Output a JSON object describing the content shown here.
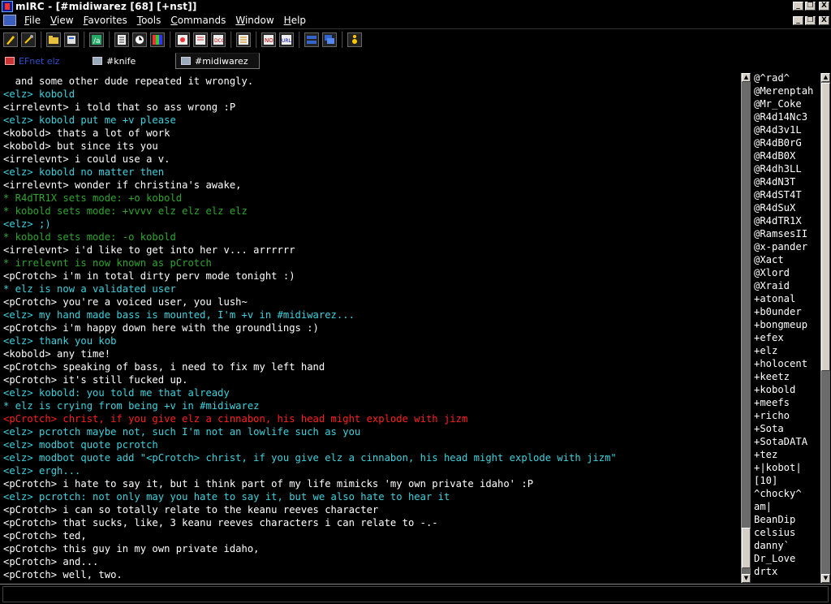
{
  "window": {
    "title": "mIRC - [#midiwarez [68] [+nst]]",
    "buttons": {
      "minimize": "_",
      "restore": "❐",
      "close": "X"
    }
  },
  "menu": [
    "File",
    "View",
    "Favorites",
    "Tools",
    "Commands",
    "Window",
    "Help"
  ],
  "toolbar": {
    "icons": [
      "connect-icon",
      "options-icon",
      "channels-folder-icon",
      "address-book-icon",
      "scripts-editor-icon",
      "dcc-send-icon",
      "timer-icon",
      "colors-icon",
      "dcc-chat-icon",
      "fonts-icon",
      "dcc-icon",
      "log-icon",
      "notify-icon",
      "url-icon",
      "tile-icon",
      "cascade-icon",
      "help-icon"
    ]
  },
  "tabs": [
    {
      "label": "EFnet elz",
      "kind": "status"
    },
    {
      "label": "#knife",
      "kind": "normal"
    },
    {
      "label": "#midiwarez",
      "kind": "active"
    }
  ],
  "colors": {
    "normal": "#ffffff",
    "self": "#3fd1dc",
    "event": "#2fa52f",
    "highlight": "#ff1f1f"
  },
  "chat": [
    {
      "t": "  and some other dude repeated it wrongly.",
      "c": "white"
    },
    {
      "t": "<elz> kobold",
      "c": "cyan"
    },
    {
      "t": "<irrelevnt> i told that so ass wrong :P",
      "c": "white"
    },
    {
      "t": "<elz> kobold put me +v please",
      "c": "cyan"
    },
    {
      "t": "<kobold> thats a lot of work",
      "c": "white"
    },
    {
      "t": "<kobold> but since its you",
      "c": "white"
    },
    {
      "t": "<irrelevnt> i could use a v.",
      "c": "white"
    },
    {
      "t": "<elz> kobold no matter then",
      "c": "cyan"
    },
    {
      "t": "<irrelevnt> wonder if christina's awake,",
      "c": "white"
    },
    {
      "t": "* R4dTR1X sets mode: +o kobold",
      "c": "green"
    },
    {
      "t": "* kobold sets mode: +vvvv elz elz elz elz",
      "c": "green"
    },
    {
      "t": "<elz> ;)",
      "c": "cyan"
    },
    {
      "t": "* kobold sets mode: -o kobold",
      "c": "green"
    },
    {
      "t": "<irrelevnt> i'd like to get into her v... arrrrrr",
      "c": "white"
    },
    {
      "t": "* irrelevnt is now known as pCrotch",
      "c": "green"
    },
    {
      "t": "<pCrotch> i'm in total dirty perv mode tonight :)",
      "c": "white"
    },
    {
      "t": "* elz is now a validated user",
      "c": "cyan"
    },
    {
      "t": "<pCrotch> you're a voiced user, you lush~",
      "c": "white"
    },
    {
      "t": "<elz> my hand made bass is mounted, I'm +v in #midiwarez...",
      "c": "cyan"
    },
    {
      "t": "<pCrotch> i'm happy down here with the groundlings :)",
      "c": "white"
    },
    {
      "t": "<elz> thank you kob",
      "c": "cyan"
    },
    {
      "t": "<kobold> any time!",
      "c": "white"
    },
    {
      "t": "<pCrotch> speaking of bass, i need to fix my left hand",
      "c": "white"
    },
    {
      "t": "<pCrotch> it's still fucked up.",
      "c": "white"
    },
    {
      "t": "<elz> kobold: you told me that already",
      "c": "cyan"
    },
    {
      "t": "* elz is crying from being +v in #midiwarez",
      "c": "cyan"
    },
    {
      "t": "<pCrotch> christ, if you give elz a cinnabon, his head might explode with jizm",
      "c": "red"
    },
    {
      "t": "<elz> pcrotch maybe not, such I'm not an lowlife such as you",
      "c": "cyan"
    },
    {
      "t": "<elz> modbot quote pcrotch",
      "c": "cyan"
    },
    {
      "t": "<elz> modbot quote add \"<pCrotch> christ, if you give elz a cinnabon, his head might explode with jizm\"",
      "c": "cyan"
    },
    {
      "t": "<elz> ergh...",
      "c": "cyan"
    },
    {
      "t": "<pCrotch> i hate to say it, but i think part of my life mimicks 'my own private idaho' :P",
      "c": "white"
    },
    {
      "t": "<elz> pcrotch: not only may you hate to say it, but we also hate to hear it",
      "c": "cyan"
    },
    {
      "t": "<pCrotch> i can so totally relate to the keanu reeves character",
      "c": "white"
    },
    {
      "t": "<pCrotch> that sucks, like, 3 keanu reeves characters i can relate to -.-",
      "c": "white"
    },
    {
      "t": "<pCrotch> ted,",
      "c": "white"
    },
    {
      "t": "<pCrotch> this guy in my own private idaho,",
      "c": "white"
    },
    {
      "t": "<pCrotch> and...",
      "c": "white"
    },
    {
      "t": "<pCrotch> well, two.",
      "c": "white"
    }
  ],
  "nicks": [
    "@^rad^",
    "@Merenptah",
    "@Mr_Coke",
    "@R4d14Nc3",
    "@R4d3v1L",
    "@R4dB0rG",
    "@R4dB0X",
    "@R4dh3LL",
    "@R4dN3T",
    "@R4dST4T",
    "@R4dSuX",
    "@R4dTR1X",
    "@RamsesII",
    "@x-pander",
    "@Xact",
    "@Xlord",
    "@Xraid",
    "+atonal",
    "+b0under",
    "+bongmeup",
    "+efex",
    "+elz",
    "+holocent",
    "+keetz",
    "+kobold",
    "+meefs",
    "+richo",
    "+Sota",
    "+SotaDATA",
    "+tez",
    "+|kobot|",
    "[10]",
    "^chocky^",
    "am|",
    "BeanDip",
    "celsius",
    "danny`",
    "Dr_Love",
    "drtx"
  ],
  "input": {
    "value": ""
  }
}
